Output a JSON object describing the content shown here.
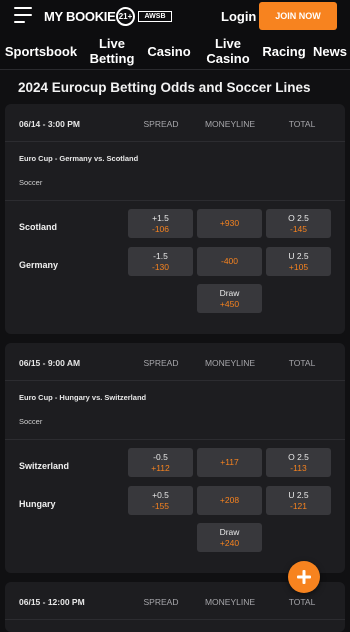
{
  "header": {
    "logo_text": "MY BOOKIE",
    "age_badge": "21+",
    "awsb_badge": "AWSB",
    "login_label": "Login",
    "join_label": "JOIN NOW",
    "accent_color": "#f7831f"
  },
  "nav": {
    "items": [
      {
        "label": "Sportsbook"
      },
      {
        "label": "Live Betting"
      },
      {
        "label": "Casino"
      },
      {
        "label": "Live Casino"
      },
      {
        "label": "Racing"
      },
      {
        "label": "News"
      }
    ]
  },
  "page": {
    "title": "2024 Eurocup Betting Odds and Soccer Lines"
  },
  "columns": {
    "spread": "SPREAD",
    "moneyline": "MONEYLINE",
    "total": "TOTAL"
  },
  "games": [
    {
      "time": "06/14 - 3:00 PM",
      "league": "Euro Cup - Germany vs. Scotland",
      "sport": "Soccer",
      "teams": [
        {
          "name": "Scotland",
          "spread_line": "+1.5",
          "spread_odds": "-106",
          "moneyline": "+930",
          "total_line": "O 2.5",
          "total_odds": "-145"
        },
        {
          "name": "Germany",
          "spread_line": "-1.5",
          "spread_odds": "-130",
          "moneyline": "-400",
          "total_line": "U 2.5",
          "total_odds": "+105"
        }
      ],
      "draw_label": "Draw",
      "draw_odds": "+450"
    },
    {
      "time": "06/15 - 9:00 AM",
      "league": "Euro Cup - Hungary vs. Switzerland",
      "sport": "Soccer",
      "teams": [
        {
          "name": "Switzerland",
          "spread_line": "-0.5",
          "spread_odds": "+112",
          "moneyline": "+117",
          "total_line": "O 2.5",
          "total_odds": "-113"
        },
        {
          "name": "Hungary",
          "spread_line": "+0.5",
          "spread_odds": "-155",
          "moneyline": "+208",
          "total_line": "U 2.5",
          "total_odds": "-121"
        }
      ],
      "draw_label": "Draw",
      "draw_odds": "+240"
    },
    {
      "time": "06/15 - 12:00 PM"
    }
  ],
  "fab_icon": "plus-icon"
}
